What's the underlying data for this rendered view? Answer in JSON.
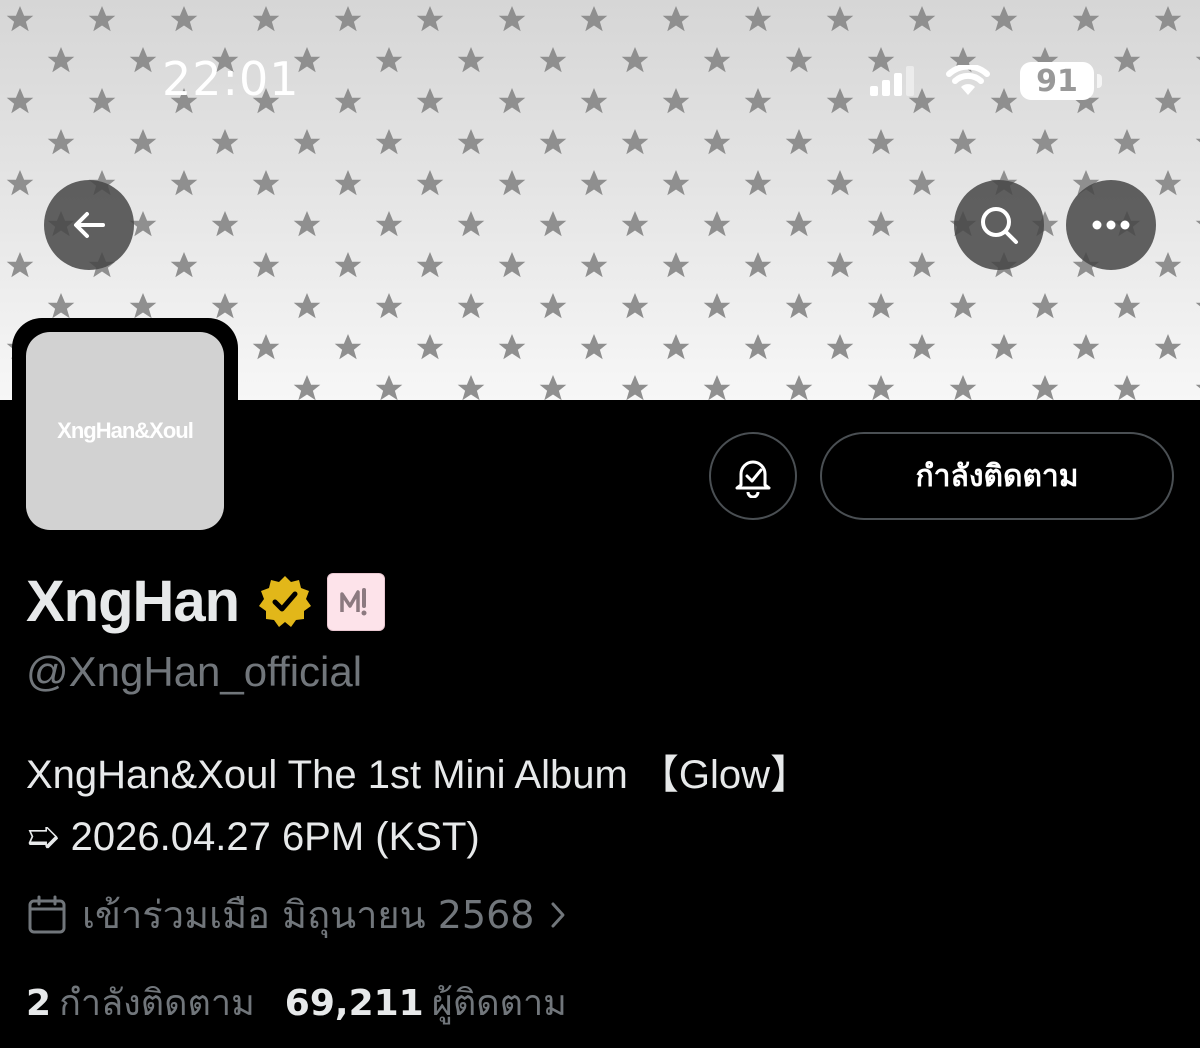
{
  "status_bar": {
    "time": "22:01",
    "battery": "91"
  },
  "profile": {
    "avatar_text": "XngHan&Xoul",
    "display_name": "XngHan",
    "handle": "@XngHan_official",
    "follow_button_label": "กำลังติดตาม",
    "bio_line1": "XngHan&Xoul The 1st Mini Album 【Glow】",
    "bio_line2": "➯ 2026.04.27 6PM (KST)",
    "joined": "เข้าร่วมเมือ มิถุนายน 2568",
    "following_count": "2",
    "following_label": "กำลังติดตาม",
    "followers_count": "69,211",
    "followers_label": "ผู้ติดตาม"
  },
  "icons": {
    "back": "back-arrow-icon",
    "search": "search-icon",
    "more": "more-icon",
    "bell": "notification-bell-icon",
    "verified": "verified-badge-icon",
    "calendar": "calendar-icon"
  },
  "colors": {
    "background": "#000000",
    "text": "#e7e9ea",
    "muted": "#71767b",
    "verified_gold": "#e2b719",
    "border": "#4a4f53"
  }
}
